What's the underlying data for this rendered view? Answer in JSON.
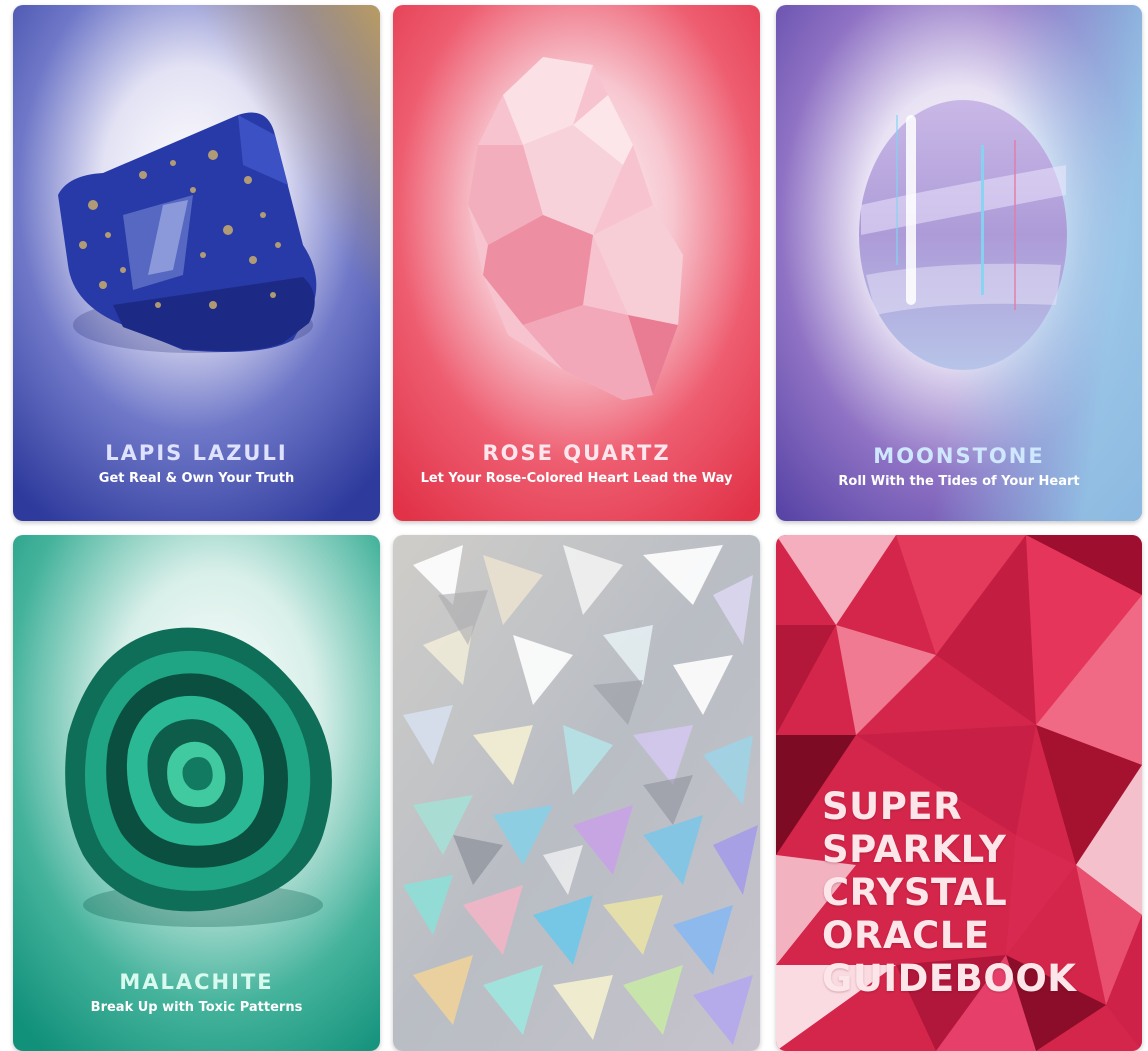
{
  "cards": [
    {
      "name": "LAPIS LAZULI",
      "subtitle": "Get Real & Own Your Truth"
    },
    {
      "name": "ROSE QUARTZ",
      "subtitle": "Let Your Rose-Colored Heart Lead the Way"
    },
    {
      "name": "MOONSTONE",
      "subtitle": "Roll With the Tides of Your Heart"
    },
    {
      "name": "MALACHITE",
      "subtitle": "Break Up with Toxic Patterns"
    }
  ],
  "card_back": {
    "pattern": "holographic-shards"
  },
  "guidebook": {
    "title_lines": [
      "SUPER",
      "SPARKLY",
      "CRYSTAL",
      "ORACLE",
      "GUIDEBOOK"
    ]
  },
  "colors": {
    "lapis": "#2f3c9e",
    "rose": "#e8384f",
    "moonstone": "#6d4fb0",
    "malachite": "#18907a",
    "ruby": "#d4264a"
  }
}
